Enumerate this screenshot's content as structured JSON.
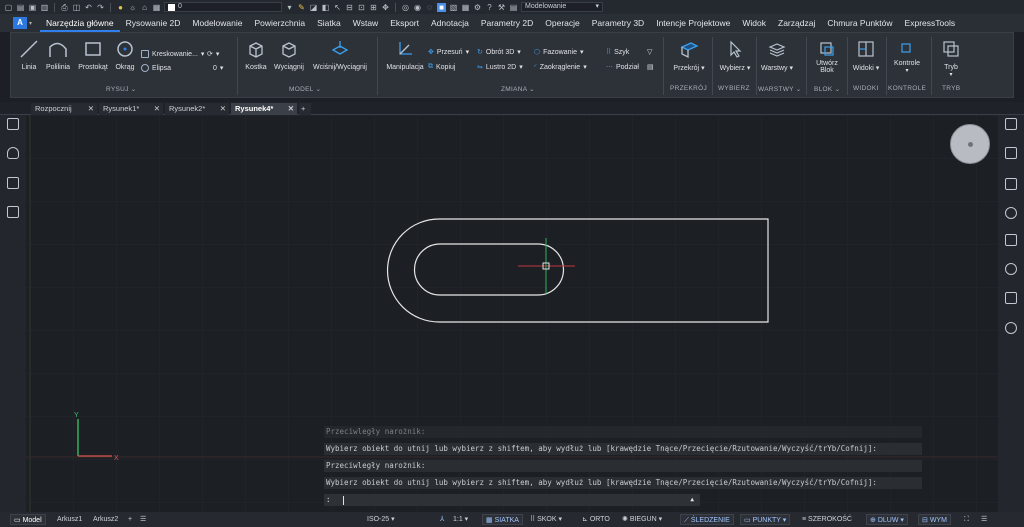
{
  "qat": {
    "layer_value": "0",
    "workspace": "Modelowanie"
  },
  "menu": [
    "Narzędzia główne",
    "Rysowanie 2D",
    "Modelowanie",
    "Powierzchnia",
    "Siatka",
    "Wstaw",
    "Eksport",
    "Adnotacja",
    "Parametry 2D",
    "Operacje",
    "Parametry 3D",
    "Intencje Projektowe",
    "Widok",
    "Zarządzaj",
    "Chmura Punktów",
    "ExpressTools"
  ],
  "ribbon": {
    "rysuj": {
      "linia": "Linia",
      "polilinia": "Polilinia",
      "prostokat": "Prostokąt",
      "okrag": "Okrąg",
      "kreskowanie": "Kreskowanie...",
      "elipsa": "Elipsa",
      "panel": "RYSUJ"
    },
    "model": {
      "kostka": "Kostka",
      "wyciagnij": "Wyciągnij",
      "wcisnij": "Wciśnij/Wyciągnij",
      "panel": "MODEL"
    },
    "zmiana": {
      "manipulacja": "Manipulacja",
      "przesun": "Przesuń",
      "kopiuj": "Kopiuj",
      "obrot3d": "Obrót 3D",
      "lustro2d": "Lustro 2D",
      "fazowanie": "Fazowanie",
      "zaokraglenie": "Zaokrąglenie",
      "szyk": "Szyk",
      "podzial": "Podział",
      "panel": "ZMIANA"
    },
    "przekroj": {
      "label": "Przekrój",
      "panel": "PRZEKRÓJ"
    },
    "wybierz": {
      "label": "Wybierz",
      "panel": "WYBIERZ"
    },
    "warstwy": {
      "label": "Warstwy",
      "panel": "WARSTWY"
    },
    "blok": {
      "label1": "Utwórz",
      "label2": "Blok",
      "panel": "BLOK"
    },
    "widoki": {
      "label": "Widoki",
      "panel": "WIDOKI"
    },
    "kontrole": {
      "label": "Kontrole",
      "panel": "KONTROLE"
    },
    "tryb": {
      "label": "Tryb",
      "panel": "TRYB"
    }
  },
  "tabs": [
    "Rozpocznij",
    "Rysunek1*",
    "Rysunek2*",
    "Rysunek4*"
  ],
  "ucs": {
    "x": "X",
    "y": "Y"
  },
  "command": {
    "lines": [
      "Przeciwległy narożnik:",
      "Wybierz obiekt do utnij lub wybierz z shiftem, aby wydłuż lub [krawędzie Tnące/Przecięcie/Rzutowanie/Wyczyść/trYb/Cofnij]:",
      "Przeciwległy narożnik:",
      "Wybierz obiekt do utnij lub wybierz z shiftem, aby wydłuż lub [krawędzie Tnące/Przecięcie/Rzutowanie/Wyczyść/trYb/Cofnij]:"
    ],
    "prompt": ":"
  },
  "status": {
    "model": "Model",
    "arkusz1": "Arkusz1",
    "arkusz2": "Arkusz2",
    "scale_style": "ISO-25",
    "ratio": "1:1",
    "siatka": "SIATKA",
    "skok": "SKOK",
    "orto": "ORTO",
    "biegun": "BIEGUN",
    "sledzenie": "ŚLEDZENIE",
    "punkty": "PUNKTY",
    "szerokosc": "SZEROKOŚĆ",
    "dluw": "DLUW",
    "wym": "WYM"
  },
  "colors": {
    "accent": "#2f80ed",
    "x_axis": "#d9534f",
    "y_axis": "#3cc46a"
  }
}
